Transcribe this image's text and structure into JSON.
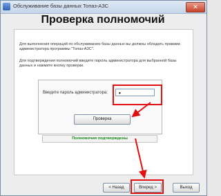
{
  "window": {
    "title": "Обслуживание базы данных Топаз-АЗС",
    "close_label": "✕"
  },
  "header": {
    "title": "Проверка полномочий"
  },
  "content": {
    "paragraph1": "Для выполнения операций по обслуживанию базы данных вы должны обладать правами администратора программы \"Топаз-АЗС\".",
    "paragraph2": "Для подтверждения полномочий введите пароль администратора для выбранной базы данных и нажмите кнопку проверки."
  },
  "login": {
    "password_label": "Введите пароль администратора:",
    "password_value": "•",
    "check_button": "Проверка",
    "status_text": "Полномочия подтверждены",
    "status_color": "#1a8a1a"
  },
  "footer": {
    "back_button": "< Назад",
    "next_button": "Вперед >",
    "exit_button": "Выход"
  },
  "annotation": {
    "highlight_color": "#e01010"
  }
}
